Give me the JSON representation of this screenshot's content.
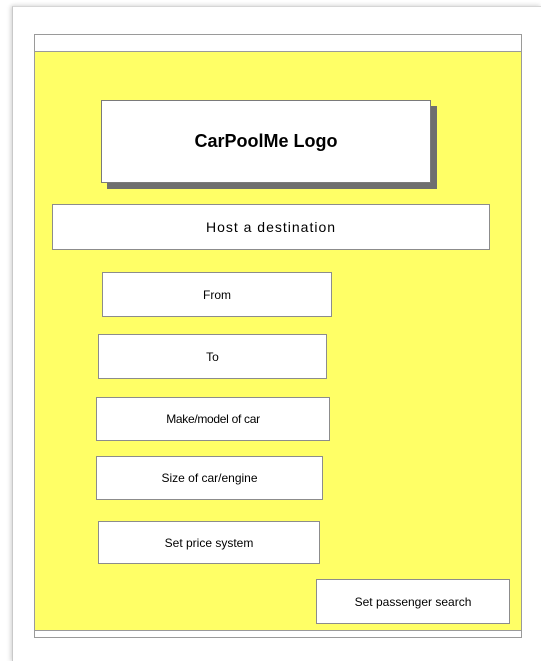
{
  "app": {
    "logo_text": "CarPoolMe Logo"
  },
  "header": {
    "host_label": "Host a destination"
  },
  "form": {
    "from_label": "From",
    "to_label": "To",
    "make_model_label": "Make/model of car",
    "size_label": "Size of car/engine",
    "price_label": "Set price system"
  },
  "actions": {
    "passenger_search_label": "Set passenger search"
  },
  "colors": {
    "screen_background": "#ffff66",
    "box_background": "#ffffff",
    "border": "#8c8c8c",
    "shadow": "#6f6f6f"
  }
}
